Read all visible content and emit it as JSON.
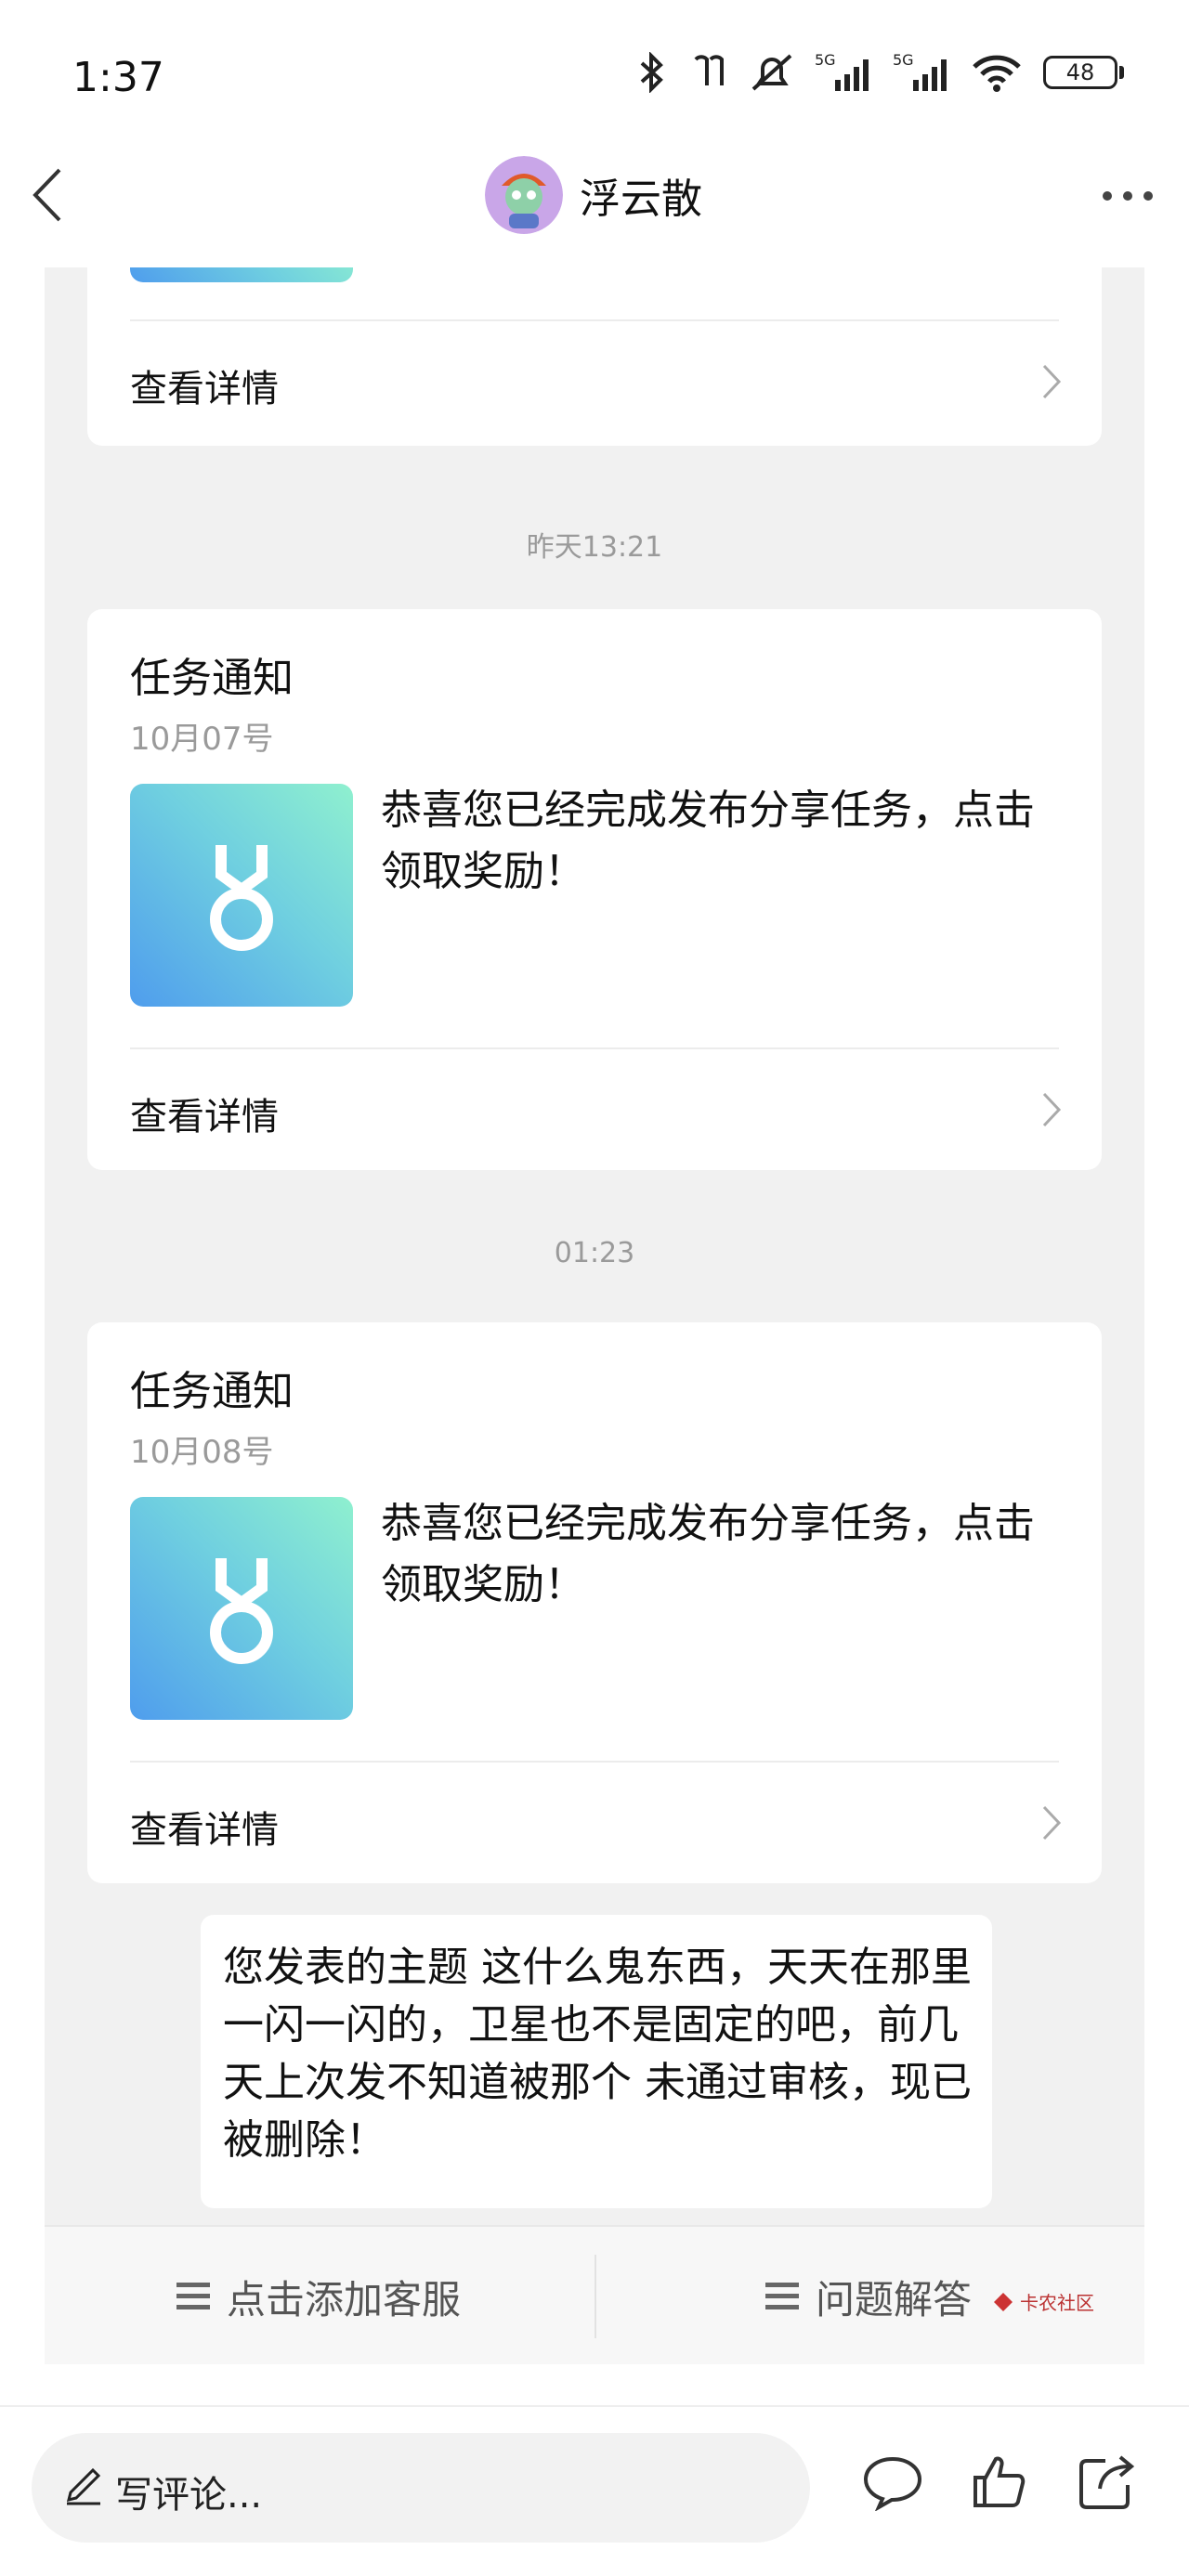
{
  "status_bar": {
    "time": "1:37",
    "battery": "48",
    "network_label_1": "5G",
    "network_label_2": "5G"
  },
  "header": {
    "title": "浮云散"
  },
  "top_card": {
    "footer_label": "查看详情"
  },
  "messages": [
    {
      "timestamp": "昨天13:21",
      "title": "任务通知",
      "date": "10月07号",
      "body": "恭喜您已经完成发布分享任务，点击领取奖励！",
      "footer_label": "查看详情"
    },
    {
      "timestamp": "01:23",
      "title": "任务通知",
      "date": "10月08号",
      "body": "恭喜您已经完成发布分享任务，点击领取奖励！",
      "footer_label": "查看详情"
    }
  ],
  "reply": {
    "text": "您发表的主题 这什么鬼东西，天天在那里一闪一闪的，卫星也不是固定的吧，前几天上次发不知道被那个 未通过审核，现已被删除！"
  },
  "bottom_tabs": {
    "left": "点击添加客服",
    "right": "问题解答",
    "watermark": "卡农社区"
  },
  "action_bar": {
    "comment_placeholder": "写评论..."
  },
  "colors": {
    "background": "#f1f1f1",
    "card": "#ffffff",
    "thumb_gradient_start": "#4f9ded",
    "thumb_gradient_end": "#8ff0cf"
  },
  "icons": [
    "back-icon",
    "more-icon",
    "medal-icon",
    "chevron-right-icon",
    "menu-icon",
    "pencil-icon",
    "comment-icon",
    "thumbs-up-icon",
    "share-icon",
    "bluetooth-icon",
    "wifi-icon",
    "mute-icon",
    "signal-icon",
    "battery-icon"
  ]
}
